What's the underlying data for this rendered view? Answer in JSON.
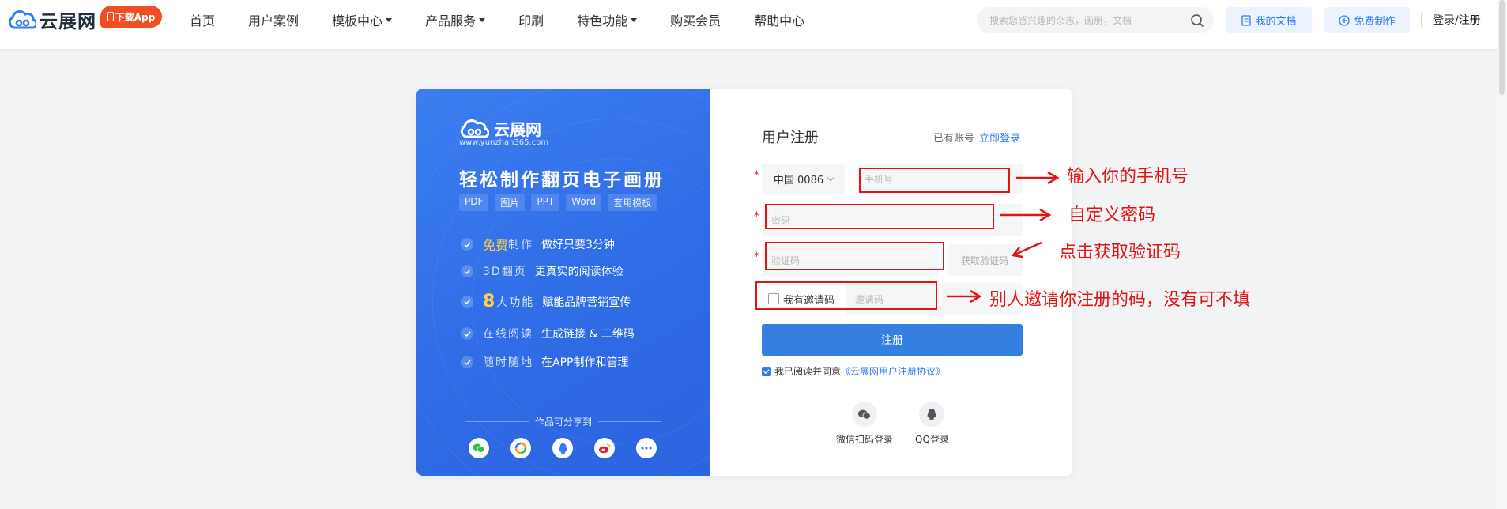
{
  "header": {
    "logo_text": "云展网",
    "app_button": "下载App",
    "nav": [
      {
        "label": "首页",
        "has_dropdown": false
      },
      {
        "label": "用户案例",
        "has_dropdown": false
      },
      {
        "label": "模板中心",
        "has_dropdown": true
      },
      {
        "label": "产品服务",
        "has_dropdown": true
      },
      {
        "label": "印刷",
        "has_dropdown": false
      },
      {
        "label": "特色功能",
        "has_dropdown": true
      },
      {
        "label": "购买会员",
        "has_dropdown": false
      },
      {
        "label": "帮助中心",
        "has_dropdown": false
      }
    ],
    "search_placeholder": "搜索您感兴趣的杂志，画册，文档",
    "my_docs": "我的文档",
    "free_make": "免费制作",
    "login_register": "登录/注册"
  },
  "promo": {
    "logo_text": "云展网",
    "url": "www.yunzhan365.com",
    "title": "轻松制作翻页电子画册",
    "tags": [
      "PDF",
      "图片",
      "PPT",
      "Word",
      "套用模板"
    ],
    "features": [
      {
        "hi": "免费",
        "light": "制作",
        "strong": "做好只要3分钟"
      },
      {
        "hi": "",
        "light": "3D翻页",
        "strong": "更真实的阅读体验"
      },
      {
        "big": "8",
        "light": "大功能",
        "strong": "赋能品牌营销宣传"
      },
      {
        "hi": "",
        "light": "在线阅读",
        "strong": "生成链接 & 二维码"
      },
      {
        "hi": "",
        "light": "随时随地",
        "strong": "在APP制作和管理"
      }
    ],
    "share_title": "作品可分享到"
  },
  "form": {
    "title": "用户注册",
    "have_account": "已有账号",
    "login_now": "立即登录",
    "country_code": "中国 0086",
    "phone_placeholder": "手机号",
    "password_placeholder": "密码",
    "code_placeholder": "验证码",
    "get_code": "获取验证码",
    "invite_checkbox": "我有邀请码",
    "invite_placeholder": "邀请码",
    "submit": "注册",
    "agree_text": "我已阅读并同意",
    "agreement_link": "《云展网用户注册协议》",
    "wechat_login": "微信扫码登录",
    "qq_login": "QQ登录"
  },
  "annotations": {
    "phone": "输入你的手机号",
    "password": "自定义密码",
    "code": "点击获取验证码",
    "invite": "别人邀请你注册的码，没有可不填"
  },
  "colors": {
    "accent": "#2f7cf6",
    "promo_blue": "#2f6ce6",
    "app_orange": "#f04e23",
    "annotation_red": "#e01414"
  }
}
